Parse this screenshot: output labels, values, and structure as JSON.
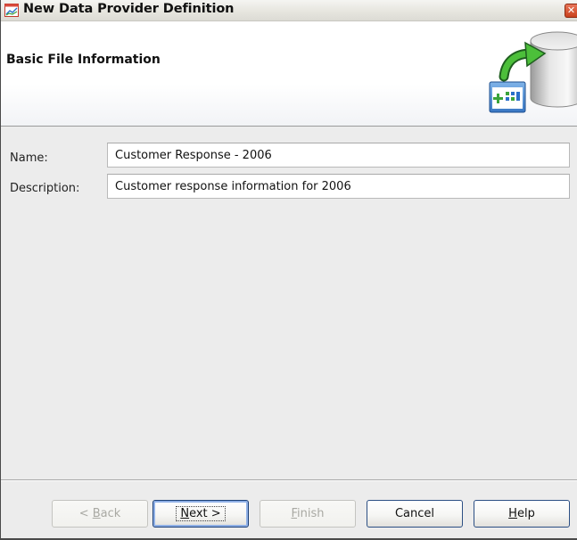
{
  "window": {
    "title": "New Data Provider Definition",
    "close_glyph": "✕"
  },
  "header": {
    "title": "Basic File Information",
    "graphic_icon": "database-add-icon"
  },
  "form": {
    "name_label": "Name:",
    "name_value": "Customer Response - 2006",
    "description_label": "Description:",
    "description_value": "Customer response information for 2006"
  },
  "buttons": {
    "back": {
      "prefix": "< ",
      "mnemonic": "B",
      "rest": "ack"
    },
    "next": {
      "mnemonic": "N",
      "rest": "ext >"
    },
    "finish": {
      "mnemonic": "F",
      "rest": "inish"
    },
    "cancel": {
      "label": "Cancel"
    },
    "help": {
      "mnemonic": "H",
      "rest": "elp"
    }
  },
  "colors": {
    "accent_green": "#3aa33a",
    "border_blue": "#2c4f84"
  }
}
